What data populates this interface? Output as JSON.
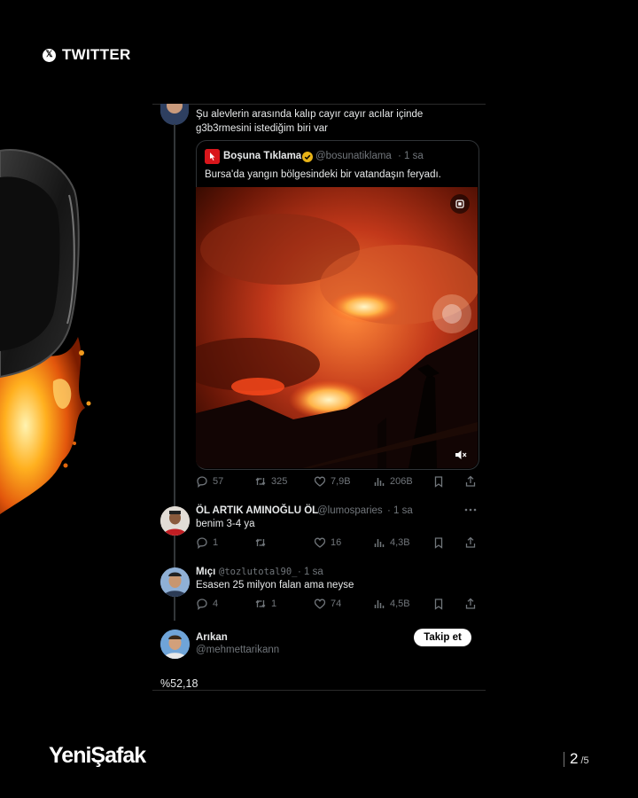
{
  "header": {
    "brand_label": "TWITTER",
    "x_glyph": "𝕏"
  },
  "main_tweet": {
    "text_line1": "Şu alevlerin arasında kalıp cayır cayır acılar içinde",
    "text_line2": "g3b3rmesini istediğim biri var"
  },
  "quoted_tweet": {
    "author": "Boşuna Tıklama",
    "handle": "@bosunatiklama",
    "time": "· 1 sa",
    "text": "Bursa'da yangın bölgesindeki bir vatandaşın feryadı."
  },
  "main_actions": {
    "replies": "57",
    "retweets": "325",
    "likes": "7,9B",
    "views": "206B"
  },
  "replies": [
    {
      "author": "ÖL ARTIK AMINOĞLU ÖL",
      "handle": "@lumosparies",
      "time": "· 1 sa",
      "text": "benim 3-4 ya",
      "replies": "1",
      "retweets": "",
      "likes": "16",
      "views": "4,3B"
    },
    {
      "author": "Mıçı",
      "handle": "@tozlutotal90_",
      "time": "· 1 sa",
      "text": "Esasen 25 milyon falan ama neyse",
      "replies": "4",
      "retweets": "1",
      "likes": "74",
      "views": "4,5B"
    }
  ],
  "suggested_user": {
    "name": "Arıkan",
    "handle": "@mehmettarikann",
    "follow_label": "Takip et"
  },
  "footer_text": "%52,18",
  "brand": {
    "logo": "YeniŞafak"
  },
  "pagination": {
    "current": "2",
    "total": "/5"
  },
  "colors": {
    "background": "#000000",
    "muted": "#71767b",
    "text": "#e7e9ea",
    "verified": "#e8b317",
    "quote_icon_red": "#d9161b"
  },
  "icons": [
    "x-logo-icon",
    "reply-icon",
    "retweet-icon",
    "like-icon",
    "views-icon",
    "bookmark-icon",
    "share-icon",
    "more-icon",
    "verified-badge-icon",
    "mute-icon",
    "expand-icon"
  ]
}
